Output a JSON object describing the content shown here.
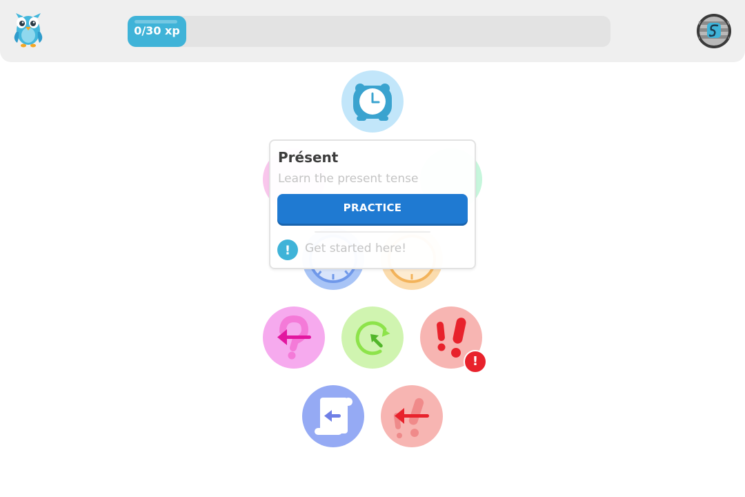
{
  "header": {
    "xp_progress": {
      "current": 0,
      "goal": 30,
      "label": "0/30 xp"
    },
    "mascot_icon": "owl-mascot-icon",
    "avatar_icon": "profile-avatar-icon"
  },
  "skills": [
    {
      "name": "alarm-clock",
      "color": "#c2e6fa"
    },
    {
      "name": "pink-question",
      "color": "#f9c6ec"
    },
    {
      "name": "green-skill",
      "color": "#c6f6dc"
    },
    {
      "name": "blue-clock",
      "color": "#a8c4f6"
    },
    {
      "name": "orange-clock",
      "color": "#fbdcae"
    },
    {
      "name": "question-back-arrow",
      "color": "#f6aaee"
    },
    {
      "name": "cycle-arrows",
      "color": "#d0f4b0"
    },
    {
      "name": "exclamation",
      "color": "#f7b5b2",
      "alert_badge": "!"
    },
    {
      "name": "scroll-back-arrow",
      "color": "#95aaf4"
    },
    {
      "name": "exclamation-back-arrow",
      "color": "#f7b5b2"
    }
  ],
  "popup": {
    "title": "Présent",
    "subtitle": "Learn the present tense",
    "button_label": "PRACTICE",
    "tip_icon_text": "!",
    "tip_text": "Get started here!"
  },
  "colors": {
    "accent_blue": "#1f7ad2",
    "xp_fill": "#3fb3d8",
    "alert_red": "#e8222c"
  }
}
